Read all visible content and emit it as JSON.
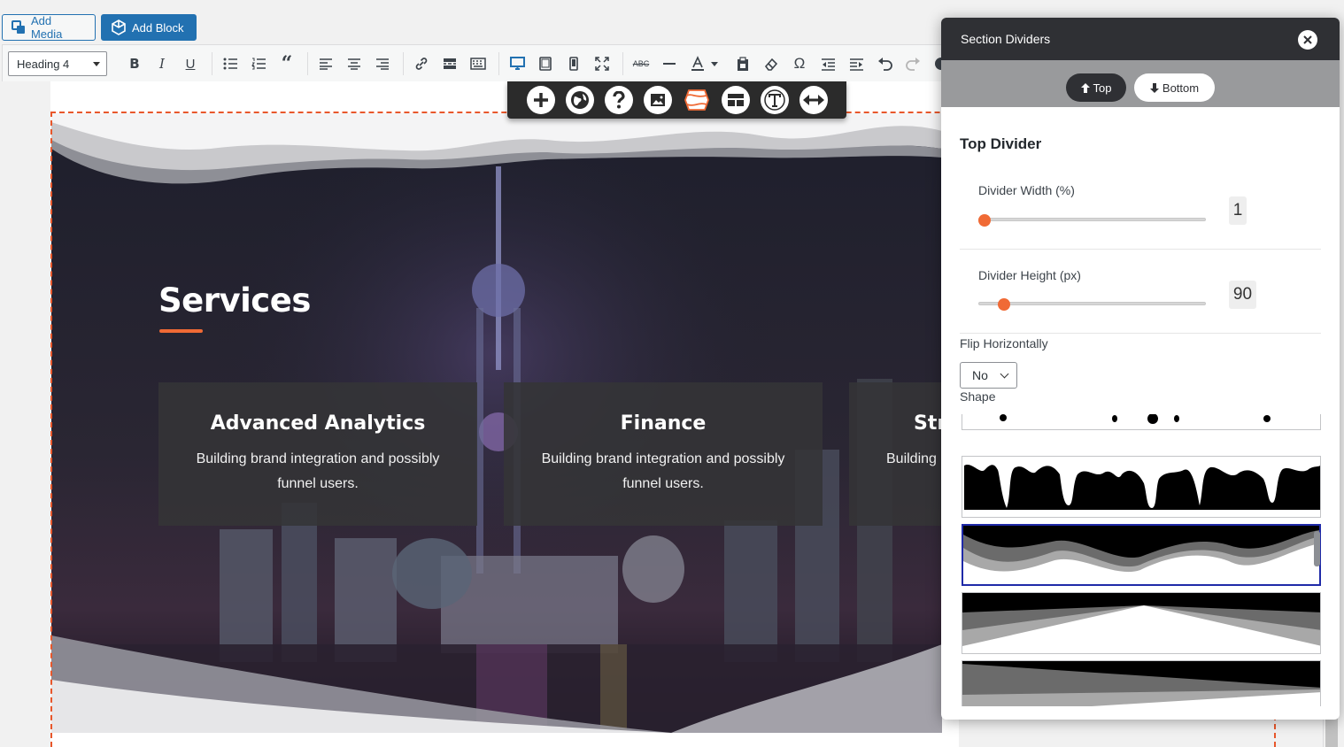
{
  "media_bar": {
    "add_media_label": "Add Media",
    "add_block_label": "Add Block"
  },
  "toolbar": {
    "format_value": "Heading 4",
    "buttons": [
      "bold",
      "italic",
      "underline",
      "bulleted-list",
      "numbered-list",
      "blockquote",
      "align-left",
      "align-center",
      "align-right",
      "link",
      "read-more",
      "toolbar-toggle",
      "desktop-view",
      "tablet-view",
      "mobile-view",
      "fullscreen",
      "strikethrough",
      "horizontal-line",
      "text-color",
      "paste-text",
      "clear-formatting",
      "special-character",
      "outdent",
      "indent",
      "undo",
      "redo"
    ]
  },
  "block_toolbar": {
    "buttons": [
      "add",
      "globe",
      "help",
      "image",
      "section-dividers",
      "layout",
      "typography",
      "width"
    ]
  },
  "hero": {
    "title": "Services",
    "cards": [
      {
        "title": "Advanced Analytics",
        "text": "Building brand integration and possibly funnel users."
      },
      {
        "title": "Finance",
        "text": "Building brand integration and possibly funnel users."
      },
      {
        "title": "Str",
        "text": "Building"
      }
    ]
  },
  "panel": {
    "title": "Section Dividers",
    "tabs": {
      "top": "Top",
      "bottom": "Bottom"
    },
    "section_title": "Top Divider",
    "width_label": "Divider Width (%)",
    "width_value": "1",
    "width_fraction": 0.0,
    "height_label": "Divider Height (px)",
    "height_value": "90",
    "height_fraction": 0.09,
    "flip_label": "Flip Horizontally",
    "flip_value": "No",
    "shape_label": "Shape",
    "shapes": [
      "drips-small",
      "drips",
      "waves-layered",
      "mountains-layered",
      "slants-layered"
    ],
    "selected_shape": "waves-layered"
  },
  "colors": {
    "accent": "#f06a35",
    "wp_blue": "#2271b1",
    "panel_dark": "#2f3034",
    "selected_border": "#1f2aa8"
  }
}
